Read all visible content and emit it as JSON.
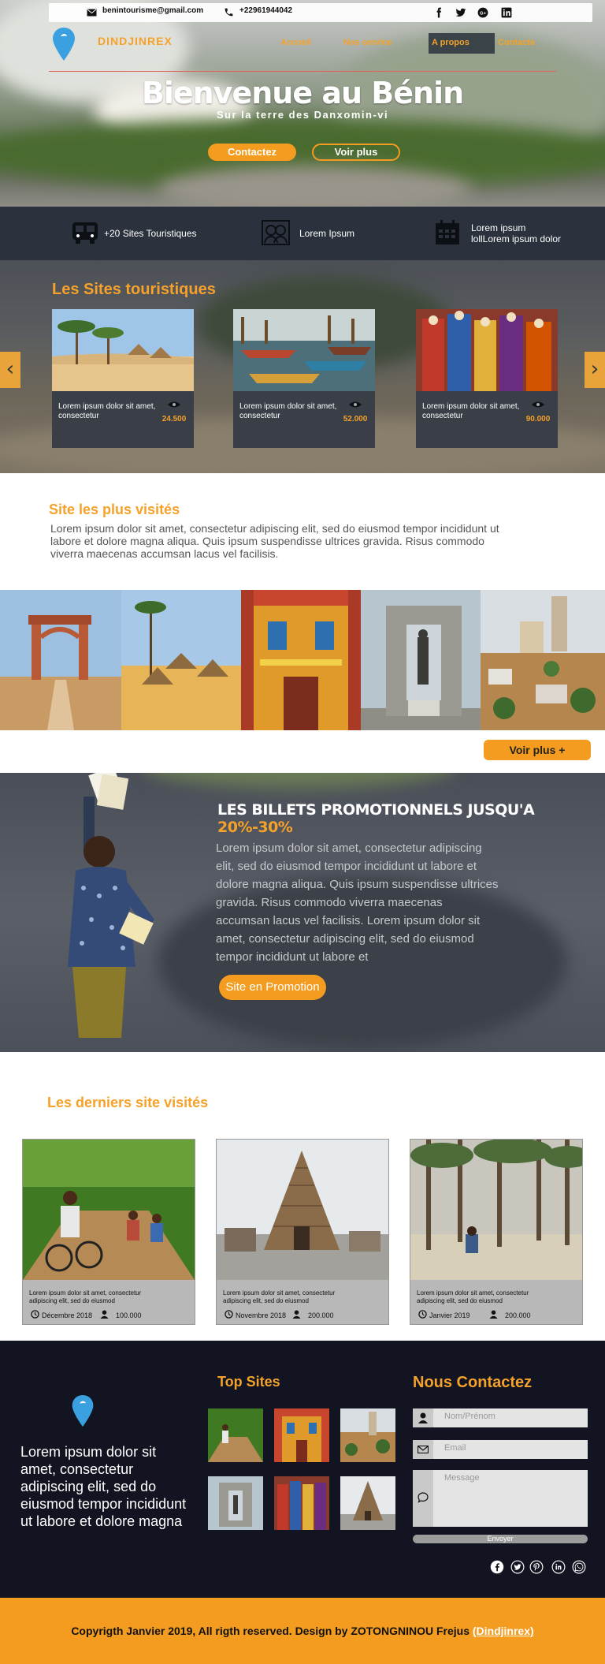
{
  "topbar": {
    "email": "benintourisme@gmail.com",
    "phone": "+22961944042"
  },
  "brand": {
    "name": "DINDJINREX"
  },
  "nav": [
    {
      "label": "Accueil"
    },
    {
      "label": "Nos service"
    },
    {
      "label": "A propos"
    },
    {
      "label": "Contacte"
    }
  ],
  "hero": {
    "title": "Bienvenue au Bénin",
    "subtitle": "Sur la terre des Danxomin-vi",
    "btn_contact": "Contactez",
    "btn_more": "Voir plus"
  },
  "features": [
    {
      "icon": "bus-icon",
      "label": "+20 Sites Touristiques"
    },
    {
      "icon": "people-icon",
      "label": "Lorem Ipsum"
    },
    {
      "icon": "calendar-icon",
      "label_line1": "Lorem ipsum",
      "label_line2": "lollLorem ipsum dolor"
    }
  ],
  "tourist_sites": {
    "title": "Les Sites touristiques",
    "cards": [
      {
        "text": "Lorem ipsum dolor sit amet, consectetur",
        "views": "24.500"
      },
      {
        "text": "Lorem ipsum dolor sit amet, consectetur",
        "views": "52.000"
      },
      {
        "text": "Lorem ipsum dolor sit amet, consectetur",
        "views": "90.000"
      }
    ],
    "prev": "‹",
    "next": "›"
  },
  "most_visited": {
    "title": "Site les plus visités",
    "text": "Lorem ipsum dolor sit amet, consectetur adipiscing elit, sed do eiusmod tempor incididunt ut labore et dolore magna aliqua. Quis ipsum suspendisse ultrices gravida. Risus commodo viverra maecenas accumsan lacus vel facilisis.",
    "btn": "Voir plus +"
  },
  "promo": {
    "title": "LES BILLETS PROMOTIONNELS JUSQU'A ",
    "percent": "20%-30%",
    "text": "Lorem ipsum dolor sit amet, consectetur adipiscing elit, sed do eiusmod tempor incididunt ut labore et dolore magna aliqua. Quis ipsum suspendisse ultrices gravida. Risus commodo viverra maecenas accumsan lacus vel facilisis. Lorem ipsum dolor sit amet, consectetur adipiscing elit, sed do eiusmod tempor incididunt ut labore et",
    "btn": "Site en Promotion"
  },
  "latest": {
    "title": "Les derniers site visités",
    "cards": [
      {
        "text": "Lorem ipsum dolor sit amet, consectetur adipiscing elit, sed do eiusmod",
        "date": "Décembre 2018",
        "count": "100.000"
      },
      {
        "text": "Lorem ipsum dolor sit amet, consectetur adipiscing elit, sed do eiusmod",
        "date": "Novembre 2018",
        "count": "200.000"
      },
      {
        "text": "Lorem ipsum dolor sit amet, consectetur adipiscing elit, sed do eiusmod",
        "date": "Janvier 2019",
        "count": "200.000"
      }
    ]
  },
  "footer": {
    "text": "Lorem ipsum dolor sit amet, consectetur adipiscing elit, sed do eiusmod tempor incididunt ut labore et dolore magna",
    "top_sites_title": "Top Sites",
    "contact_title": "Nous Contactez",
    "name_placeholder": "Nom/Prénom",
    "email_placeholder": "Email",
    "message_placeholder": "Message",
    "send": "Envoyer"
  },
  "copyright": {
    "text": "Copyrigth Janvier 2019, All rigth reserved. Design by ZOTONGNINOU Frejus ",
    "link": "(Dindjinrex)"
  },
  "colors": {
    "accent": "#f39c1f",
    "dark": "#2b323d",
    "footer": "#121521"
  }
}
